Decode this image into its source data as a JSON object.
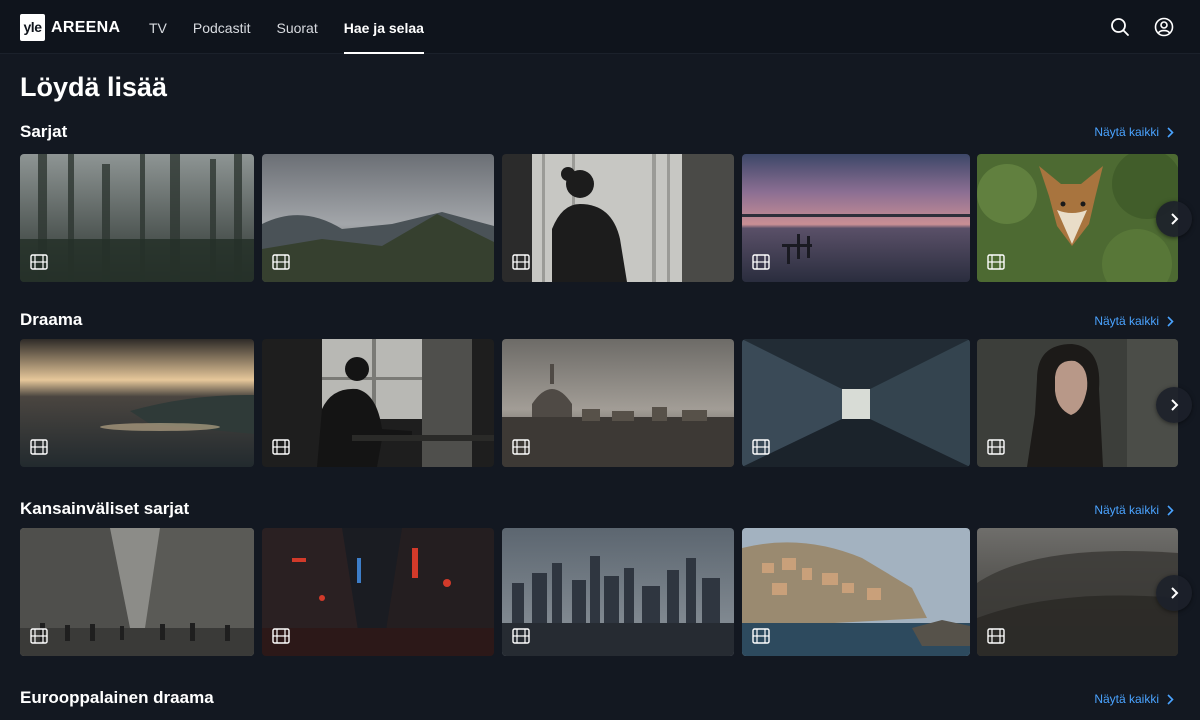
{
  "brand": {
    "logo_mark": "yle",
    "name": "AREENA"
  },
  "nav": {
    "items": [
      {
        "label": "TV",
        "active": false
      },
      {
        "label": "Podcastit",
        "active": false
      },
      {
        "label": "Suorat",
        "active": false
      },
      {
        "label": "Hae ja selaa",
        "active": true
      }
    ]
  },
  "header_icons": [
    "search-icon",
    "user-account-icon"
  ],
  "page": {
    "title": "Löydä lisää"
  },
  "colors": {
    "background": "#131821",
    "accent_link": "#4aa3ff",
    "header": "#0f141c"
  },
  "rows": [
    {
      "title": "Sarjat",
      "show_all": "Näytä kaikki",
      "cards": [
        {
          "scene": "misty forest",
          "icon": "film-icon"
        },
        {
          "scene": "cloudy mountains",
          "icon": "film-icon"
        },
        {
          "scene": "woman silhouette at window",
          "icon": "film-icon"
        },
        {
          "scene": "lake pier at dusk",
          "icon": "film-icon"
        },
        {
          "scene": "fox in greenery",
          "icon": "film-icon"
        }
      ]
    },
    {
      "title": "Draama",
      "show_all": "Näytä kaikki",
      "cards": [
        {
          "scene": "sunrays over sea",
          "icon": "film-icon"
        },
        {
          "scene": "man at window table",
          "icon": "film-icon"
        },
        {
          "scene": "city cathedral skyline",
          "icon": "film-icon"
        },
        {
          "scene": "long corridor",
          "icon": "film-icon"
        },
        {
          "scene": "woman portrait",
          "icon": "film-icon"
        }
      ]
    },
    {
      "title": "Kansainväliset sarjat",
      "show_all": "Näytä kaikki",
      "cards": [
        {
          "scene": "busy city street",
          "icon": "film-icon"
        },
        {
          "scene": "neon alley at night",
          "icon": "film-icon"
        },
        {
          "scene": "skyscraper skyline",
          "icon": "film-icon"
        },
        {
          "scene": "coastal village",
          "icon": "film-icon"
        },
        {
          "scene": "foggy forest hill",
          "icon": "film-icon"
        }
      ]
    },
    {
      "title": "Eurooppalainen draama",
      "show_all": "Näytä kaikki",
      "cards": []
    }
  ]
}
